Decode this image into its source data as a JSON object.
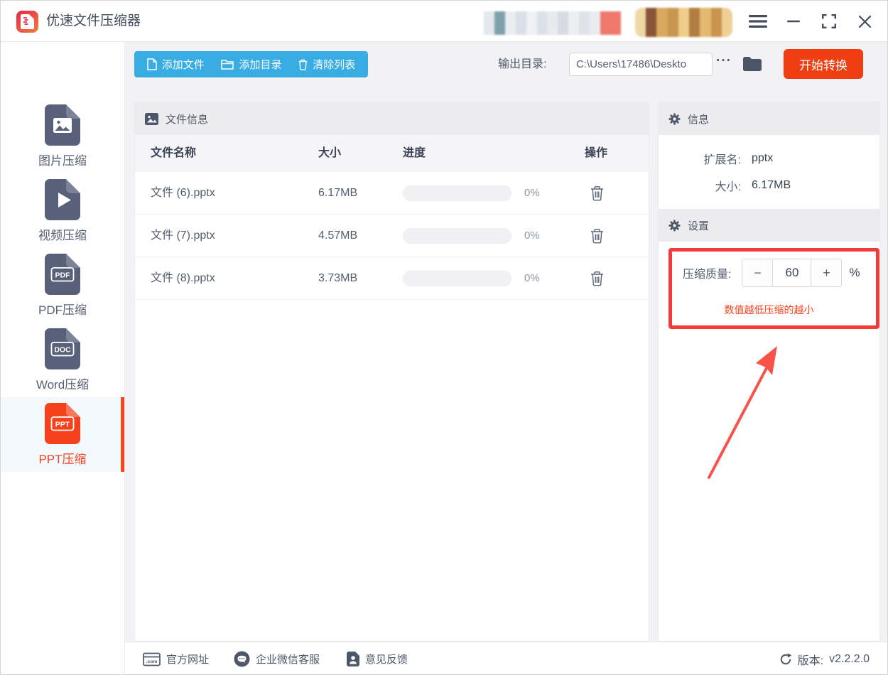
{
  "titlebar": {
    "title": "优速文件压缩器",
    "icons": [
      "app-logo-zip-doc-icon",
      "redacted-badge",
      "redacted-avatar",
      "hamburger-menu-icon",
      "minimize-icon",
      "maximize-icon",
      "close-icon"
    ]
  },
  "sidebar": {
    "items": [
      {
        "label": "图片压缩",
        "icon": "image-doc-icon",
        "active": false
      },
      {
        "label": "视频压缩",
        "icon": "video-doc-icon",
        "active": false
      },
      {
        "label": "PDF压缩",
        "icon": "pdf-doc-icon",
        "badge": "PDF",
        "active": false
      },
      {
        "label": "Word压缩",
        "icon": "word-doc-icon",
        "badge": "DOC",
        "active": false
      },
      {
        "label": "PPT压缩",
        "icon": "ppt-doc-icon",
        "badge": "PPT",
        "active": true
      }
    ]
  },
  "toolbar": {
    "add_file": "添加文件",
    "add_dir": "添加目录",
    "clear_list": "清除列表",
    "output_label": "输出目录:",
    "output_path": "C:\\Users\\17486\\Deskto",
    "more": "···",
    "start": "开始转换"
  },
  "file_panel": {
    "header": "文件信息",
    "columns": [
      "文件名称",
      "大小",
      "进度",
      "操作"
    ],
    "rows": [
      {
        "name": "文件 (6).pptx",
        "size": "6.17MB",
        "progress": "0%"
      },
      {
        "name": "文件 (7).pptx",
        "size": "4.57MB",
        "progress": "0%"
      },
      {
        "name": "文件 (8).pptx",
        "size": "3.73MB",
        "progress": "0%"
      }
    ]
  },
  "info_panel": {
    "header": "信息",
    "ext_label": "扩展名:",
    "ext_value": "pptx",
    "size_label": "大小:",
    "size_value": "6.17MB"
  },
  "settings_panel": {
    "header": "设置",
    "quality_label": "压缩质量:",
    "minus": "−",
    "value": "60",
    "plus": "+",
    "percent": "%",
    "note": "数值越低压缩的越小"
  },
  "footer": {
    "website": "官方网址",
    "wechat": "企业微信客服",
    "feedback": "意见反馈",
    "version_label": "版本:",
    "version": "v2.2.2.0"
  },
  "colors": {
    "accent_blue": "#39ADE3",
    "accent_red": "#EE3E12",
    "ppt_red": "#F5421D",
    "annotation_red": "#F23B3B",
    "slate": "#4E5769"
  }
}
